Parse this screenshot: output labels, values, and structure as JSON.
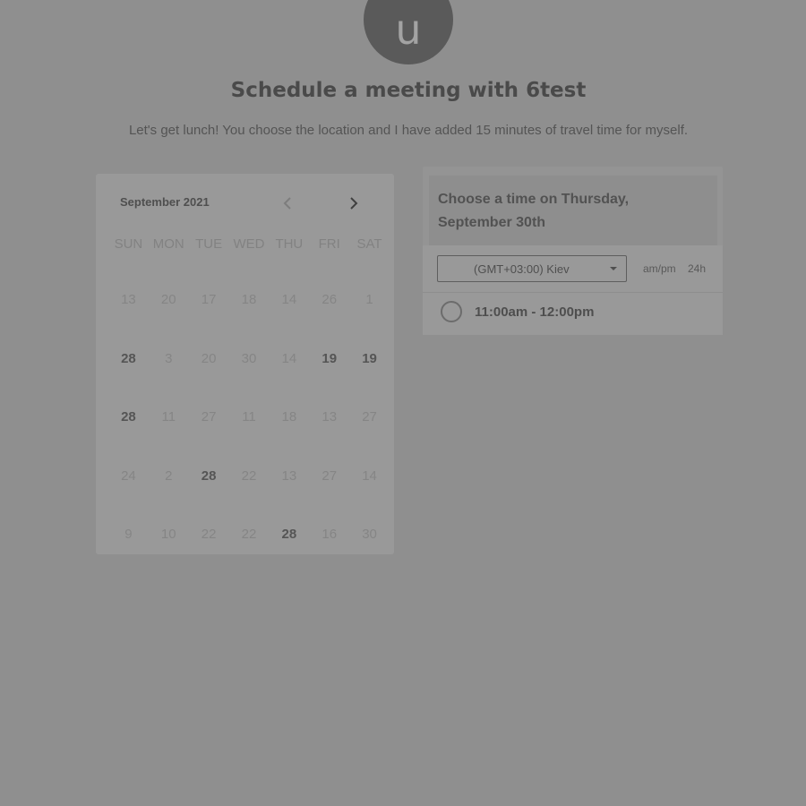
{
  "header": {
    "avatar_letter": "u",
    "title": "Schedule a meeting with 6test",
    "subtitle": "Let's get lunch! You choose the location and I have added 15 minutes of travel time for myself."
  },
  "calendar": {
    "month_label": "September 2021",
    "prev_icon": "chevron-left-icon",
    "next_icon": "chevron-right-icon",
    "weekdays": [
      "SUN",
      "MON",
      "TUE",
      "WED",
      "THU",
      "FRI",
      "SAT"
    ],
    "weeks": [
      [
        {
          "d": "13",
          "b": false
        },
        {
          "d": "20",
          "b": false
        },
        {
          "d": "17",
          "b": false
        },
        {
          "d": "18",
          "b": false
        },
        {
          "d": "14",
          "b": false
        },
        {
          "d": "26",
          "b": false
        },
        {
          "d": "1",
          "b": false
        }
      ],
      [
        {
          "d": "28",
          "b": true
        },
        {
          "d": "3",
          "b": false
        },
        {
          "d": "20",
          "b": false
        },
        {
          "d": "30",
          "b": false
        },
        {
          "d": "14",
          "b": false
        },
        {
          "d": "19",
          "b": true
        },
        {
          "d": "19",
          "b": true
        }
      ],
      [
        {
          "d": "28",
          "b": true
        },
        {
          "d": "11",
          "b": false
        },
        {
          "d": "27",
          "b": false
        },
        {
          "d": "11",
          "b": false
        },
        {
          "d": "18",
          "b": false
        },
        {
          "d": "13",
          "b": false
        },
        {
          "d": "27",
          "b": false
        }
      ],
      [
        {
          "d": "24",
          "b": false
        },
        {
          "d": "2",
          "b": false
        },
        {
          "d": "28",
          "b": true
        },
        {
          "d": "22",
          "b": false
        },
        {
          "d": "13",
          "b": false
        },
        {
          "d": "27",
          "b": false
        },
        {
          "d": "14",
          "b": false
        }
      ],
      [
        {
          "d": "9",
          "b": false
        },
        {
          "d": "10",
          "b": false
        },
        {
          "d": "22",
          "b": false
        },
        {
          "d": "22",
          "b": false
        },
        {
          "d": "28",
          "b": true
        },
        {
          "d": "16",
          "b": false
        },
        {
          "d": "30",
          "b": false
        }
      ]
    ]
  },
  "time_panel": {
    "title": "Choose a time on Thursday, September 30th",
    "timezone": "(GMT+03:00) Kiev",
    "format_ampm": "am/pm",
    "format_24": "24h",
    "slot": "11:00am - 12:00pm"
  },
  "colors": {
    "background": "#8f8f8f",
    "avatar": "#5a5a5a"
  }
}
